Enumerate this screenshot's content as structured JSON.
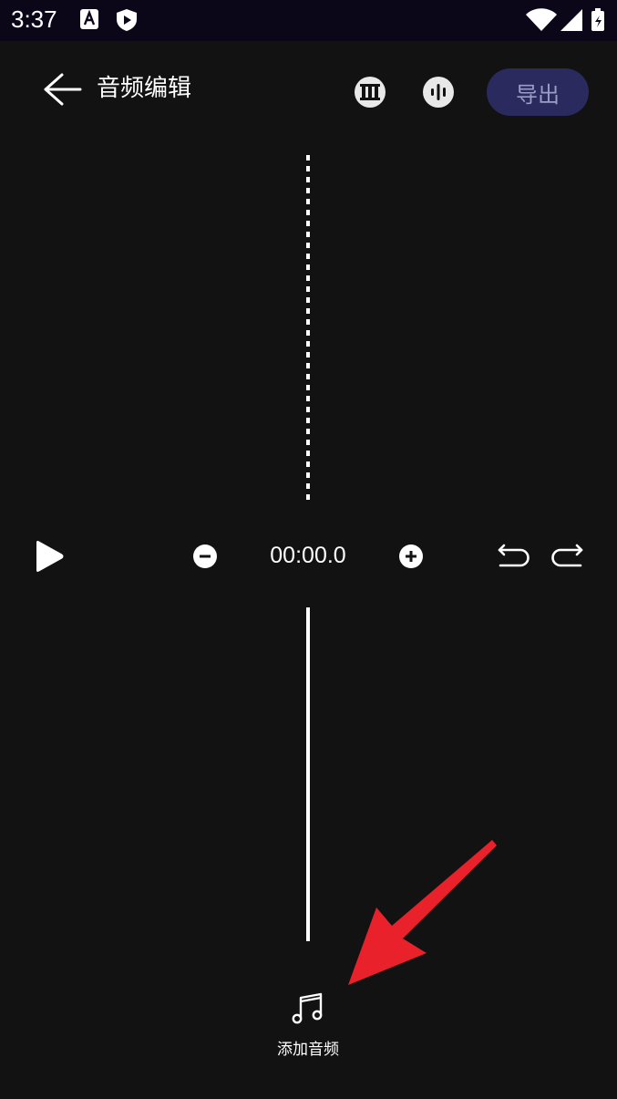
{
  "status_bar": {
    "time": "3:37",
    "icons": [
      "font-a-icon",
      "shield-play-icon",
      "wifi-icon",
      "signal-icon",
      "battery-icon"
    ]
  },
  "header": {
    "title": "音频编辑",
    "export_label": "导出",
    "tools": [
      "piano-keys-icon",
      "waveform-icon"
    ]
  },
  "controls": {
    "time": "00:00.0"
  },
  "add_audio": {
    "label": "添加音频"
  },
  "colors": {
    "background": "#121212",
    "status_bar": "#0b0618",
    "export_bg": "#2a2a5e",
    "export_text": "#9c9cc4",
    "annotation_arrow": "#e8212a"
  }
}
